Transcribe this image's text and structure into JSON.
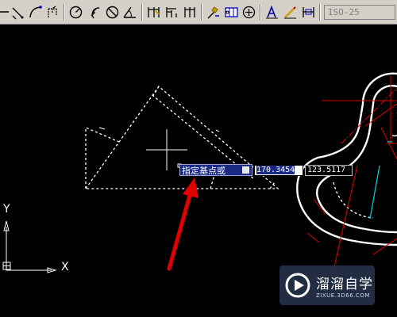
{
  "toolbar": {
    "icons": [
      "dim-linear-icon",
      "dim-aligned-icon",
      "dim-arc-length-icon",
      "dim-ordinate-icon",
      "dim-radius-icon",
      "dim-jogged-icon",
      "dim-diameter-icon",
      "dim-angular-icon",
      "quick-dimension-icon",
      "dim-baseline-icon",
      "dim-continue-icon",
      "quick-leader-icon",
      "tolerance-icon",
      "center-mark-icon",
      "dim-edit-icon",
      "dim-text-edit-icon",
      "dim-update-icon"
    ],
    "dim_style": "ISO-25"
  },
  "dynamic_input": {
    "prompt": "指定基点或",
    "x_value": "170.3454",
    "y_value": "123.5117"
  },
  "ucs": {
    "x_label": "X",
    "y_label": "Y"
  },
  "watermark": {
    "title": "溜溜自学",
    "url": "ZIXUE.3D66.COM"
  },
  "colors": {
    "canvas": "#000000",
    "prompt_bg": "#1b2a85",
    "annotation_arrow": "#e00000",
    "crosshair": "#ffffff"
  }
}
